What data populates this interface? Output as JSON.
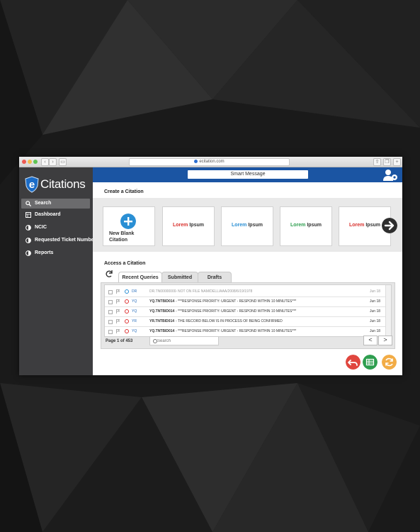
{
  "browser": {
    "url": "ecitation.com"
  },
  "app": {
    "logo_text": "Citations",
    "logo_letter": "e"
  },
  "sidebar": {
    "items": [
      {
        "label": "Search",
        "icon": "search-icon",
        "active": true
      },
      {
        "label": "Dashboard",
        "icon": "dashboard-icon"
      },
      {
        "label": "NCIC",
        "icon": "half-circle-icon"
      },
      {
        "label": "Requested Ticket Numbers",
        "icon": "half-circle-icon"
      },
      {
        "label": "Reports",
        "icon": "half-circle-icon"
      }
    ]
  },
  "topbar": {
    "smart_message": "Smart Message",
    "user_icon": "user-settings-icon"
  },
  "create": {
    "title": "Create a Citation",
    "new_blank": "New Blank Citation",
    "cards": [
      {
        "word1": "Lorem",
        "word2": "Ipsum",
        "color": "#d9302c"
      },
      {
        "word1": "Lorem",
        "word2": "Ipsum",
        "color": "#2a8fd4"
      },
      {
        "word1": "Lorem",
        "word2": "Ipsum",
        "color": "#2e9e4f"
      },
      {
        "word1": "Lorem",
        "word2": "Ipsum",
        "color": "#d9302c"
      }
    ]
  },
  "access": {
    "title": "Access a Citation",
    "tabs": [
      "Recent Queries",
      "Submitted",
      "Drafts"
    ],
    "rows": [
      {
        "code": "DR",
        "id": "DR.TN00000000",
        "msg": "- NOT ON FILE NAM/DELL/AAA/2008/6/19/1978",
        "date": "Jun 18",
        "dim": true
      },
      {
        "code": "YQ",
        "id": "YQ.TNTBID014",
        "msg": "- ***RESPONSE PRIORITY: URGENT - RESPOND WITHIN 10 MINUTES***",
        "date": "Jun 18"
      },
      {
        "code": "YQ",
        "id": "YQ.TNTBID014",
        "msg": "- ***RESPONSE PRIORITY: URGENT - RESPOND WITHIN 10 MINUTES***",
        "date": "Jun 18"
      },
      {
        "code": "YR",
        "id": "YR.TNTBID014",
        "msg": "- THE RECORD BELOW IS IN PROCESS OF BEING CONFIRMED",
        "date": "Jun 18"
      },
      {
        "code": "YQ",
        "id": "YQ.TNTBID014",
        "msg": "- ***RESPONSE PRIORITY: URGENT - RESPOND WITHIN 10 MINUTES***",
        "date": "Jun 18"
      }
    ],
    "pager": "Page 1 of 453",
    "search_placeholder": "Search",
    "prev": "<",
    "next": ">"
  },
  "actions": [
    {
      "icon": "back-arrow-icon",
      "color": "#e0463e"
    },
    {
      "icon": "spreadsheet-icon",
      "color": "#2e9e4f"
    },
    {
      "icon": "refresh-icon",
      "color": "#f2ac46"
    }
  ]
}
